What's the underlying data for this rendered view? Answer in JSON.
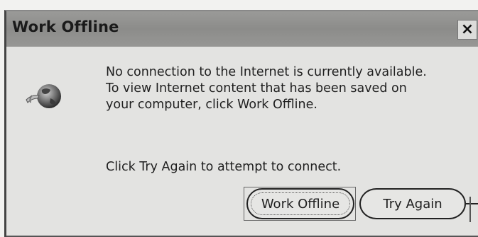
{
  "dialog": {
    "title": "Work Offline",
    "close_label": "×",
    "icon": "globe-disconnected-icon",
    "message_lines": [
      "No connection to the Internet is currently available.",
      "To view Internet content that has been saved on",
      "your computer, click Work Offline."
    ],
    "retry_text": "Click Try Again to attempt to connect.",
    "buttons": {
      "work_offline": "Work Offline",
      "try_again": "Try Again"
    }
  }
}
